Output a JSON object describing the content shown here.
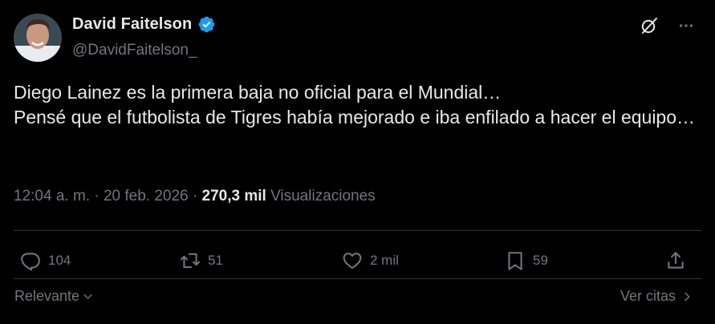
{
  "author": {
    "display_name": "David Faitelson",
    "handle": "@DavidFaitelson_",
    "verified": true,
    "verified_color": "#1d9bf0"
  },
  "post": {
    "lines": [
      "Diego Lainez es la primera baja no oficial para el Mundial…",
      "Pensé que el futbolista de Tigres había mejorado e iba enfilado a hacer el equipo…"
    ]
  },
  "meta": {
    "time": "12:04 a. m.",
    "separator": " · ",
    "date": "20 feb. 2026",
    "views_count": "270,3 mil",
    "views_label": "Visualizaciones"
  },
  "actions": {
    "replies": "104",
    "reposts": "51",
    "likes": "2 mil",
    "bookmarks": "59"
  },
  "footer": {
    "sort_label": "Relevante",
    "quotes_label": "Ver citas"
  },
  "icons": {
    "grok": "grok-icon",
    "more": "more-icon",
    "reply": "reply-icon",
    "repost": "repost-icon",
    "like": "heart-icon",
    "bookmark": "bookmark-icon",
    "share": "share-icon"
  },
  "colors": {
    "background": "#000000",
    "text_primary": "#e7e9ea",
    "text_secondary": "#71767b",
    "divider": "#2f3336"
  }
}
